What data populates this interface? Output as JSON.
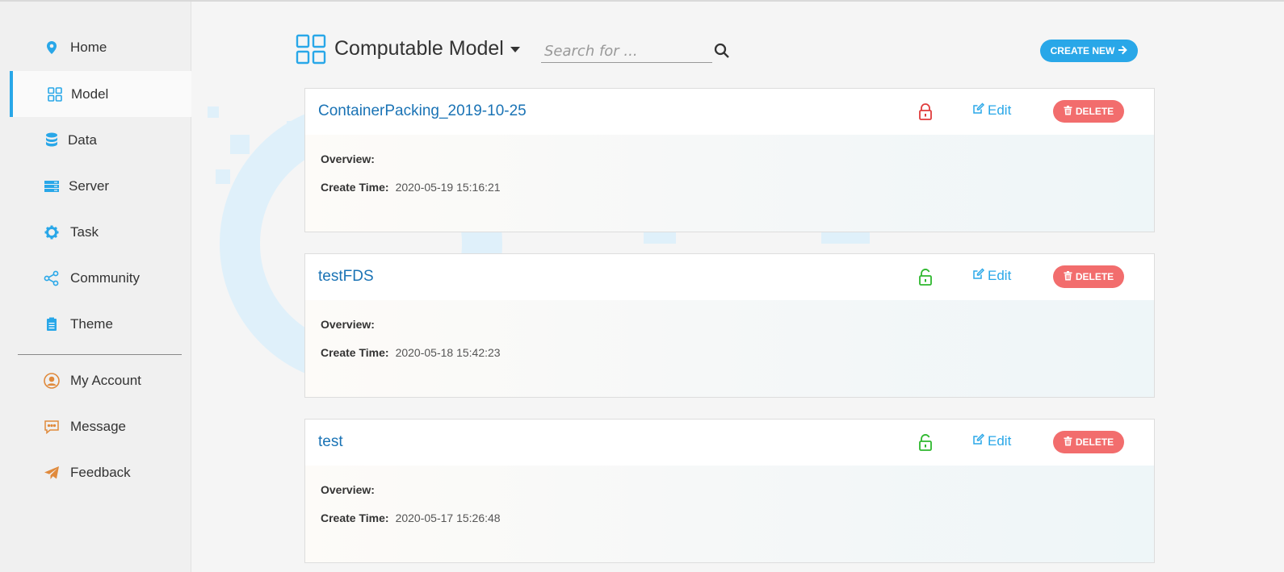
{
  "sidebar": {
    "items": [
      {
        "label": "Home",
        "icon": "location-pin-icon",
        "color": "#29a7e8"
      },
      {
        "label": "Model",
        "icon": "grid-icon",
        "color": "#29a7e8",
        "active": true
      },
      {
        "label": "Data",
        "icon": "database-icon",
        "color": "#29a7e8"
      },
      {
        "label": "Server",
        "icon": "server-icon",
        "color": "#29a7e8"
      },
      {
        "label": "Task",
        "icon": "gear-icon",
        "color": "#29a7e8"
      },
      {
        "label": "Community",
        "icon": "share-icon",
        "color": "#29a7e8"
      },
      {
        "label": "Theme",
        "icon": "clipboard-icon",
        "color": "#29a7e8"
      },
      {
        "label": "My Account",
        "icon": "user-circle-icon",
        "color": "#e08a3c"
      },
      {
        "label": "Message",
        "icon": "comment-icon",
        "color": "#e08a3c"
      },
      {
        "label": "Feedback",
        "icon": "paper-plane-icon",
        "color": "#e08a3c"
      }
    ]
  },
  "header": {
    "title": "Computable Model",
    "search_placeholder": "Search for ...",
    "create_label": "CREATE NEW"
  },
  "colors": {
    "accent": "#29a7e8",
    "danger": "#f26d6d",
    "title_link": "#1a73b5",
    "locked": "#e03c3c",
    "unlocked": "#2eb82e"
  },
  "models": [
    {
      "name": "ContainerPacking_2019-10-25",
      "lock": "locked",
      "edit": "Edit",
      "delete": "DELETE",
      "overview_label": "Overview:",
      "overview": "",
      "create_time_label": "Create Time:",
      "create_time": "2020-05-19 15:16:21"
    },
    {
      "name": "testFDS",
      "lock": "unlocked",
      "edit": "Edit",
      "delete": "DELETE",
      "overview_label": "Overview:",
      "overview": "",
      "create_time_label": "Create Time:",
      "create_time": "2020-05-18 15:42:23"
    },
    {
      "name": "test",
      "lock": "unlocked",
      "edit": "Edit",
      "delete": "DELETE",
      "overview_label": "Overview:",
      "overview": "",
      "create_time_label": "Create Time:",
      "create_time": "2020-05-17 15:26:48"
    }
  ]
}
